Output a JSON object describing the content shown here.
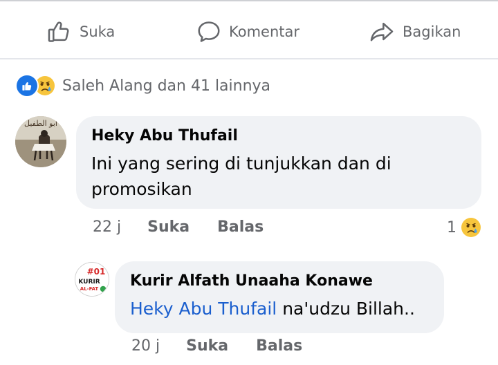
{
  "actions": {
    "like_label": "Suka",
    "comment_label": "Komentar",
    "share_label": "Bagikan"
  },
  "reactions": {
    "summary": "Saleh Alang dan 41 lainnya",
    "icons": [
      "like-icon",
      "sad-icon"
    ]
  },
  "comments": [
    {
      "author": "Heky Abu Thufail",
      "text": "Ini yang sering di tunjukkan dan di promosikan",
      "time": "22 j",
      "like_label": "Suka",
      "reply_label": "Balas",
      "reaction_count": "1",
      "avatar_text": "أبو الطفيل"
    },
    {
      "author": "Kurir Alfath Unaaha Konawe",
      "mention": "Heky Abu Thufail",
      "text": " na'udzu Billah..",
      "time": "20 j",
      "like_label": "Suka",
      "reply_label": "Balas",
      "avatar_text_top": "#01",
      "avatar_text_mid": "KURIR",
      "avatar_text_bottom": "AL-FAT"
    }
  ],
  "colors": {
    "link": "#1b5fce",
    "like_blue": "#1b74e4",
    "muted": "#65676b",
    "bubble": "#f0f2f5"
  }
}
